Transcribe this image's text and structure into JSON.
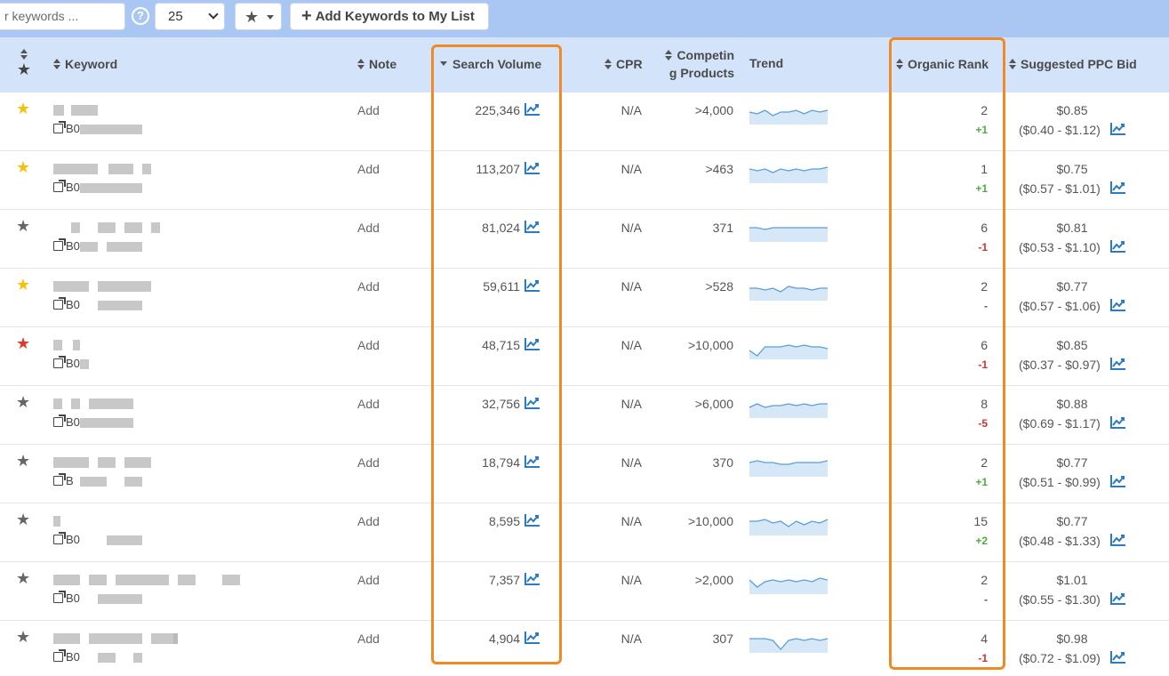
{
  "toolbar": {
    "search_placeholder": "r keywords ...",
    "help_icon": "?",
    "per_page": "25",
    "star_filter_icon": "star-icon",
    "add_button_label": "Add Keywords to My List"
  },
  "columns": {
    "keyword": "Keyword",
    "note": "Note",
    "search_volume": "Search Volume",
    "cpr": "CPR",
    "competing_1": "Competin",
    "competing_2": "g Products",
    "trend": "Trend",
    "organic_rank": "Organic Rank",
    "ppc_bid": "Suggested PPC Bid"
  },
  "colors": {
    "highlight": "#f08a24",
    "star_gold": "#f4c20d",
    "star_red": "#e0392d",
    "star_grey": "#666666",
    "trend_line": "#5a9fd8",
    "trend_fill": "#d6e7f8"
  },
  "rows": [
    {
      "star": "gold",
      "asin": "B0",
      "note": "Add",
      "volume": "225,346",
      "cpr": "N/A",
      "competing": ">4,000",
      "rank": "2",
      "rank_change": "+1",
      "bid": "$0.85",
      "bid_range": "($0.40 - $1.12)",
      "trend": [
        5,
        4,
        6,
        3,
        5,
        5,
        6,
        4,
        6,
        5,
        6
      ]
    },
    {
      "star": "gold",
      "asin": "B0",
      "note": "Add",
      "volume": "113,207",
      "cpr": "N/A",
      "competing": ">463",
      "rank": "1",
      "rank_change": "+1",
      "bid": "$0.75",
      "bid_range": "($0.57 - $1.01)",
      "trend": [
        6,
        5,
        6,
        4,
        6,
        5,
        6,
        5,
        6,
        6,
        7
      ]
    },
    {
      "star": "grey",
      "asin": "B0",
      "note": "Add",
      "volume": "81,024",
      "cpr": "N/A",
      "competing": "371",
      "rank": "6",
      "rank_change": "-1",
      "bid": "$0.81",
      "bid_range": "($0.53 - $1.10)",
      "trend": [
        6,
        6,
        5,
        6,
        6,
        6,
        6,
        6,
        6,
        6,
        6
      ]
    },
    {
      "star": "gold",
      "asin": "B0",
      "note": "Add",
      "volume": "59,611",
      "cpr": "N/A",
      "competing": ">528",
      "rank": "2",
      "rank_change": "-",
      "bid": "$0.77",
      "bid_range": "($0.57 - $1.06)",
      "trend": [
        5,
        5,
        4,
        5,
        3,
        6,
        5,
        5,
        4,
        5,
        5
      ]
    },
    {
      "star": "red",
      "asin": "B0",
      "note": "Add",
      "volume": "48,715",
      "cpr": "N/A",
      "competing": ">10,000",
      "rank": "6",
      "rank_change": "-1",
      "bid": "$0.85",
      "bid_range": "($0.37 - $0.97)",
      "trend": [
        3,
        0,
        5,
        5,
        5,
        6,
        5,
        6,
        5,
        5,
        4
      ]
    },
    {
      "star": "grey",
      "asin": "B0",
      "note": "Add",
      "volume": "32,756",
      "cpr": "N/A",
      "competing": ">6,000",
      "rank": "8",
      "rank_change": "-5",
      "bid": "$0.88",
      "bid_range": "($0.69 - $1.17)",
      "trend": [
        4,
        6,
        4,
        5,
        5,
        6,
        5,
        6,
        5,
        6,
        6
      ]
    },
    {
      "star": "grey",
      "asin": "B",
      "note": "Add",
      "volume": "18,794",
      "cpr": "N/A",
      "competing": "370",
      "rank": "2",
      "rank_change": "+1",
      "bid": "$0.77",
      "bid_range": "($0.51 - $0.99)",
      "trend": [
        6,
        7,
        6,
        6,
        5,
        5,
        6,
        6,
        6,
        6,
        7
      ]
    },
    {
      "star": "grey",
      "asin": "B0",
      "note": "Add",
      "volume": "8,595",
      "cpr": "N/A",
      "competing": ">10,000",
      "rank": "15",
      "rank_change": "+2",
      "bid": "$0.77",
      "bid_range": "($0.48 - $1.33)",
      "trend": [
        6,
        6,
        7,
        5,
        6,
        3,
        6,
        4,
        6,
        5,
        7
      ]
    },
    {
      "star": "grey",
      "asin": "B0",
      "note": "Add",
      "volume": "7,357",
      "cpr": "N/A",
      "competing": ">2,000",
      "rank": "2",
      "rank_change": "-",
      "bid": "$1.01",
      "bid_range": "($0.55 - $1.30)",
      "trend": [
        6,
        2,
        5,
        6,
        5,
        6,
        5,
        6,
        5,
        7,
        6
      ]
    },
    {
      "star": "grey",
      "asin": "B0",
      "note": "Add",
      "volume": "4,904",
      "cpr": "N/A",
      "competing": "307",
      "rank": "4",
      "rank_change": "-1",
      "bid": "$0.98",
      "bid_range": "($0.72 - $1.09)",
      "trend": [
        6,
        6,
        6,
        5,
        0,
        5,
        6,
        5,
        6,
        5,
        6
      ]
    }
  ]
}
